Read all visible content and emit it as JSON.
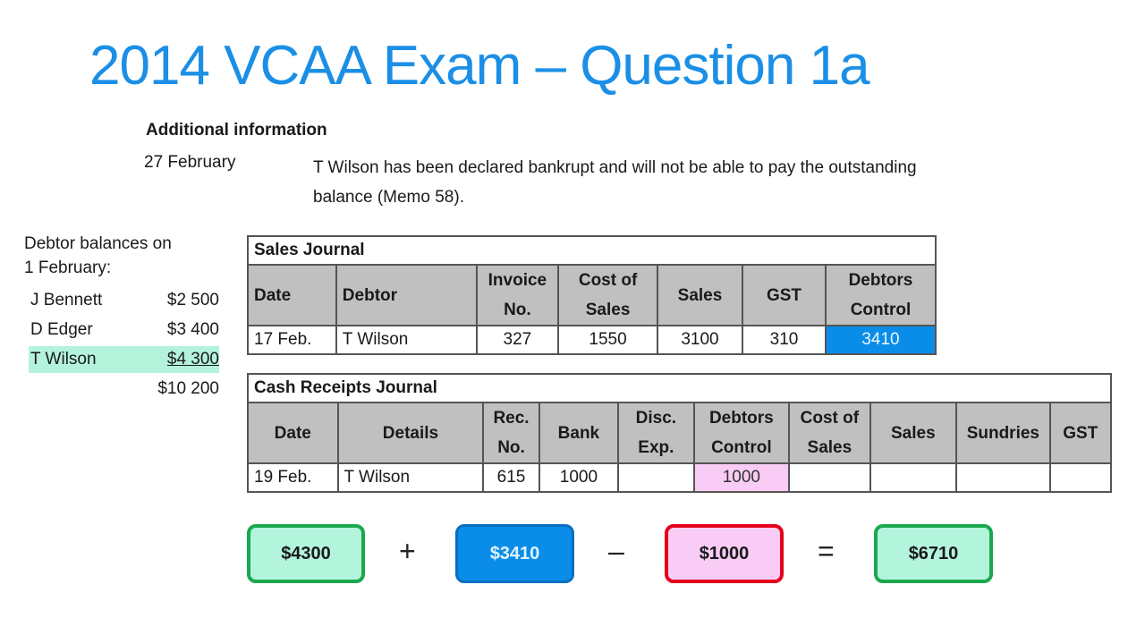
{
  "title": "2014 VCAA Exam – Question 1a",
  "additional_info": {
    "heading": "Additional information",
    "date": "27 February",
    "text": "T Wilson has been declared bankrupt and will not be able to pay the outstanding balance (Memo 58)."
  },
  "debtor_balances": {
    "caption_line1": "Debtor balances on",
    "caption_line2": "1 February:",
    "rows": [
      {
        "name": "J Bennett",
        "amount": "$2 500"
      },
      {
        "name": "D Edger",
        "amount": "$3 400"
      },
      {
        "name": "T Wilson",
        "amount": "$4 300",
        "highlight": true
      }
    ],
    "total": "$10 200"
  },
  "sales_journal": {
    "title": "Sales Journal",
    "headers": [
      "Date",
      "Debtor",
      "Invoice No.",
      "Cost of Sales",
      "Sales",
      "GST",
      "Debtors Control"
    ],
    "rows": [
      [
        "17 Feb.",
        "T Wilson",
        "327",
        "1550",
        "3100",
        "310",
        "3410"
      ]
    ]
  },
  "cash_receipts_journal": {
    "title": "Cash Receipts Journal",
    "headers": [
      "Date",
      "Details",
      "Rec. No.",
      "Bank",
      "Disc. Exp.",
      "Debtors Control",
      "Cost of Sales",
      "Sales",
      "Sundries",
      "GST"
    ],
    "rows": [
      [
        "19 Feb.",
        "T Wilson",
        "615",
        "1000",
        "",
        "1000",
        "",
        "",
        "",
        ""
      ]
    ]
  },
  "equation": {
    "terms": [
      "$4300",
      "$3410",
      "$1000",
      "$6710"
    ],
    "operators": [
      "+",
      "–",
      "="
    ],
    "colors": {
      "green_fill": "#b3f5dc",
      "green_border": "#1aa84f",
      "blue_fill": "#0a8de8",
      "blue_border": "#0a6fc0",
      "pink_fill": "#f8ccf4",
      "red_border": "#e4001b"
    }
  }
}
